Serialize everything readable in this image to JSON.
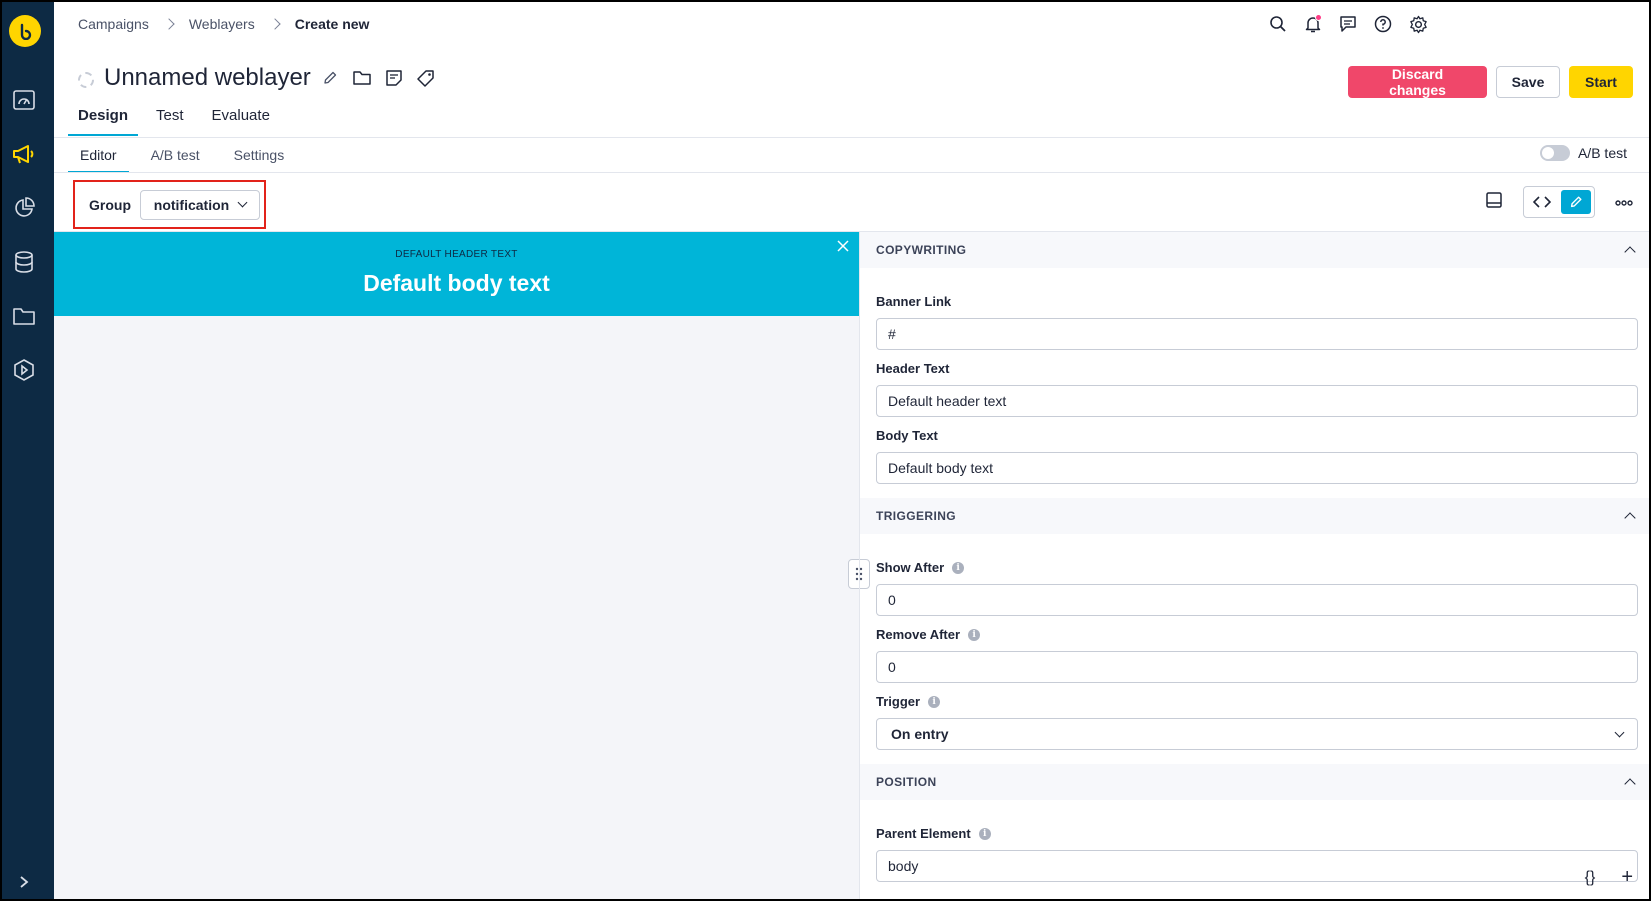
{
  "breadcrumb": {
    "items": [
      "Campaigns",
      "Weblayers"
    ],
    "current": "Create new"
  },
  "title": "Unnamed weblayer",
  "actions": {
    "discard": "Discard changes",
    "save": "Save",
    "start": "Start"
  },
  "tabs": [
    "Design",
    "Test",
    "Evaluate"
  ],
  "subtabs": [
    "Editor",
    "A/B test",
    "Settings"
  ],
  "ab_toggle_label": "A/B test",
  "group": {
    "label": "Group",
    "value": "notification"
  },
  "banner": {
    "header": "DEFAULT HEADER TEXT",
    "body": "Default body text"
  },
  "sections": {
    "copywriting": "COPYWRITING",
    "triggering": "TRIGGERING",
    "position": "POSITION"
  },
  "fields": {
    "banner_link": {
      "label": "Banner Link",
      "value": "#"
    },
    "header_text": {
      "label": "Header Text",
      "value": "Default header text"
    },
    "body_text": {
      "label": "Body Text",
      "value": "Default body text"
    },
    "show_after": {
      "label": "Show After",
      "value": "0"
    },
    "remove_after": {
      "label": "Remove After",
      "value": "0"
    },
    "trigger": {
      "label": "Trigger",
      "value": "On entry"
    },
    "parent_element": {
      "label": "Parent Element",
      "value": "body"
    }
  },
  "bottom_tools": {
    "braces": "{}",
    "plus": "+"
  },
  "colors": {
    "sidebar": "#0d2a44",
    "accent": "#00a7d4",
    "brand_yellow": "#ffd500",
    "discard": "#f0476a",
    "banner": "#00b5d8",
    "highlight_box": "#e2231a"
  }
}
